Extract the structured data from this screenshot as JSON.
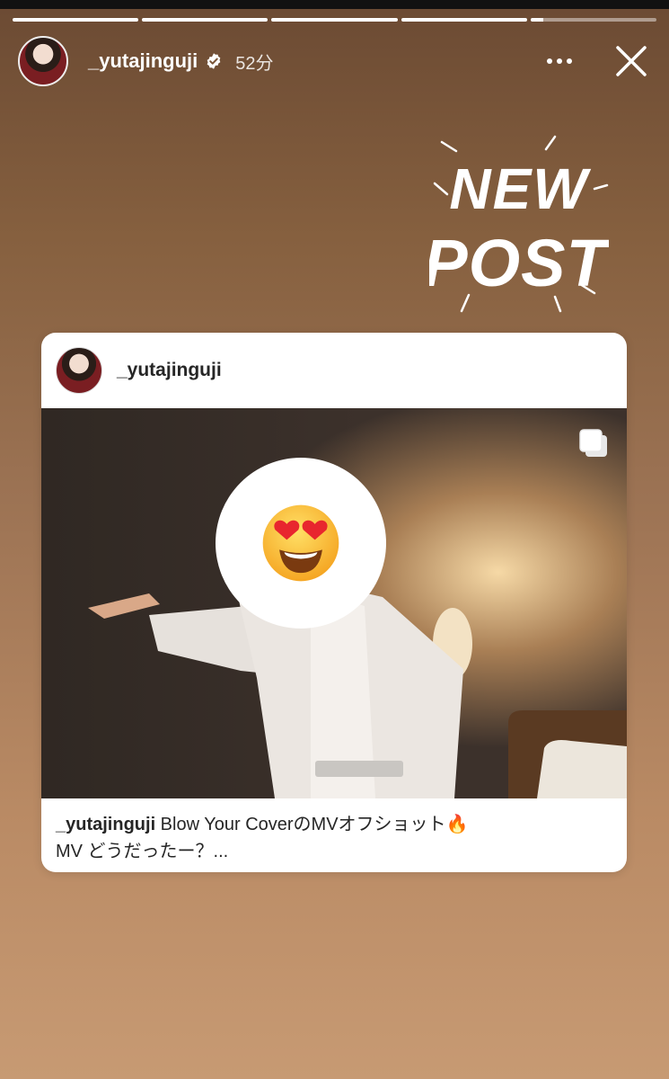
{
  "story": {
    "progress": [
      1.0,
      1.0,
      1.0,
      1.0,
      0.1
    ],
    "username": "_yutajinguji",
    "time": "52分"
  },
  "sticker": {
    "line1": "NEW",
    "line2": "POST"
  },
  "post": {
    "username": "_yutajinguji",
    "caption_user": "_yutajinguji",
    "caption_text": " Blow Your CoverのMVオフショット🔥",
    "caption_line2": "MV どうだったー？..."
  },
  "icons": {
    "verified": "verified-badge-icon",
    "more": "more-options-icon",
    "close": "close-icon",
    "multi": "multiple-photos-icon",
    "emoji": "heart-eyes-emoji"
  }
}
